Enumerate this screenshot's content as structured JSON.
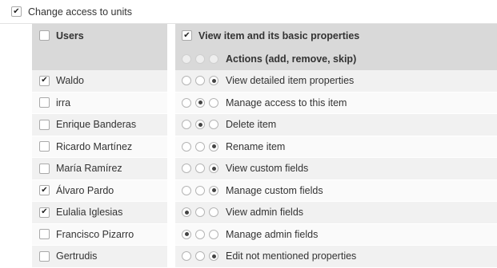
{
  "top": {
    "label": "Change access to units",
    "checked": true
  },
  "users": {
    "header": "Users",
    "header_checked": false,
    "rows": [
      {
        "name": "Waldo",
        "checked": true
      },
      {
        "name": "irra",
        "checked": false
      },
      {
        "name": "Enrique Banderas",
        "checked": false
      },
      {
        "name": "Ricardo Martínez",
        "checked": false
      },
      {
        "name": "María Ramírez",
        "checked": false
      },
      {
        "name": "Álvaro Pardo",
        "checked": true
      },
      {
        "name": "Eulalia Iglesias",
        "checked": true
      },
      {
        "name": "Francisco Pizarro",
        "checked": false
      },
      {
        "name": "Gertrudis",
        "checked": false
      }
    ]
  },
  "permissions": {
    "header_view": "View item and its basic properties",
    "header_view_checked": true,
    "header_actions": "Actions (add, remove, skip)",
    "rows": [
      {
        "label": "View detailed item properties",
        "selected": 2
      },
      {
        "label": "Manage access to this item",
        "selected": 1
      },
      {
        "label": "Delete item",
        "selected": 1
      },
      {
        "label": "Rename item",
        "selected": 2
      },
      {
        "label": "View custom fields",
        "selected": 2
      },
      {
        "label": "Manage custom fields",
        "selected": 2
      },
      {
        "label": "View admin fields",
        "selected": 0
      },
      {
        "label": "Manage admin fields",
        "selected": 0
      },
      {
        "label": "Edit not mentioned properties",
        "selected": 2
      }
    ]
  }
}
